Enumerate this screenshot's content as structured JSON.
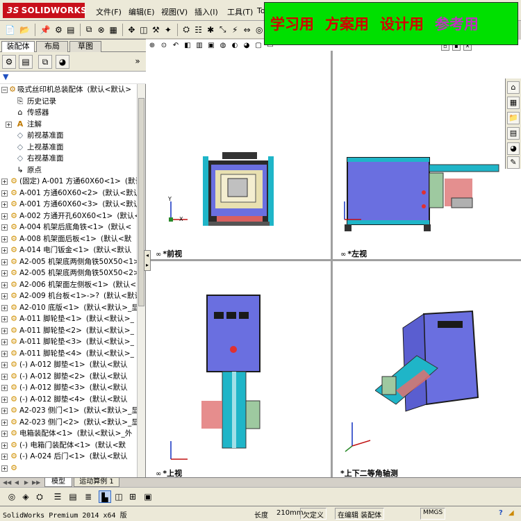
{
  "app": {
    "logo_text": "SOLIDWORKS",
    "logo_mark": "3S"
  },
  "menu": [
    {
      "label": "文件(F)"
    },
    {
      "label": "编辑(E)"
    },
    {
      "label": "视图(V)"
    },
    {
      "label": "插入(I)"
    },
    {
      "label": "工具(T)"
    },
    {
      "label": "To"
    }
  ],
  "banner": {
    "text1": "学习用",
    "text2": "方案用",
    "text3": "设计用",
    "text4": "参考用"
  },
  "panel": {
    "tabs": [
      {
        "label": "装配体"
      },
      {
        "label": "布局"
      },
      {
        "label": "草图"
      }
    ],
    "root_label": "吸式丝印机总装配体",
    "root_suffix": "(默认<默认>",
    "items": [
      {
        "label": "历史记录",
        "icon": "history-icon"
      },
      {
        "label": "传感器",
        "icon": "sensor-icon"
      },
      {
        "label": "注解",
        "icon": "annotation-icon"
      },
      {
        "label": "前视基准面",
        "icon": "plane-icon"
      },
      {
        "label": "上视基准面",
        "icon": "plane-icon"
      },
      {
        "label": "右视基准面",
        "icon": "plane-icon"
      },
      {
        "label": "原点",
        "icon": "origin-icon"
      },
      {
        "label": "(固定) A-001 方通60X60<1>",
        "suffix": "(默认"
      },
      {
        "label": "A-001 方通60X60<2>",
        "suffix": "(默认<默认"
      },
      {
        "label": "A-001 方通60X60<3>",
        "suffix": "(默认<默认"
      },
      {
        "label": "A-002 方通开孔60X60<1>",
        "suffix": "(默认<"
      },
      {
        "label": "A-004 机架后底角铁<1>",
        "suffix": "(默认<"
      },
      {
        "label": "A-008 机架面后板<1>",
        "suffix": "(默认<默"
      },
      {
        "label": "A-014 电门钣金<1>",
        "suffix": "(默认<默认"
      },
      {
        "label": "A2-005 机架底两侧角铁50X50<1>",
        "suffix": ""
      },
      {
        "label": "A2-005 机架底两侧角铁50X50<2>",
        "suffix": ""
      },
      {
        "label": "A2-006 机架面左侧板<1>",
        "suffix": "(默认<"
      },
      {
        "label": "A2-009 机台板<1>->?",
        "suffix": "(默认<默认"
      },
      {
        "label": "A2-010 底版<1>",
        "suffix": "(默认<默认>_显"
      },
      {
        "label": "A-011 脚轮垫<1>",
        "suffix": "(默认<默认>_"
      },
      {
        "label": "A-011 脚轮垫<2>",
        "suffix": "(默认<默认>_"
      },
      {
        "label": "A-011 脚轮垫<3>",
        "suffix": "(默认<默认>_"
      },
      {
        "label": "A-011 脚轮垫<4>",
        "suffix": "(默认<默认>_"
      },
      {
        "label": "(-) A-012 脚垫<1>",
        "suffix": "(默认<默认"
      },
      {
        "label": "(-) A-012 脚垫<2>",
        "suffix": "(默认<默认"
      },
      {
        "label": "(-) A-012 脚垫<3>",
        "suffix": "(默认<默认"
      },
      {
        "label": "(-) A-012 脚垫<4>",
        "suffix": "(默认<默认"
      },
      {
        "label": "A2-023 侧门<1>",
        "suffix": "(默认<默认>_显"
      },
      {
        "label": "A2-023 侧门<2>",
        "suffix": "(默认<默认>_显"
      },
      {
        "label": "电箱装配体<1>",
        "suffix": "(默认<默认>_外"
      },
      {
        "label": "(-) 电箱门装配体<1>",
        "suffix": "(默认<默"
      },
      {
        "label": "(-) A-024 后门<1>",
        "suffix": "(默认<默认"
      }
    ]
  },
  "viewports": {
    "front": "*前视",
    "left": "*左视",
    "top": "*上视",
    "iso": "*上下二等角轴测",
    "axis_x": "X",
    "axis_y": "Y"
  },
  "bottom_tabs": [
    {
      "label": "模型"
    },
    {
      "label": "运动算例 1"
    }
  ],
  "status": {
    "version": "SolidWorks Premium 2014 x64 版",
    "length_label": "长度",
    "length_value": "210mm",
    "undefined": "欠定义",
    "editing": "在编辑 装配体",
    "units": "MMGS",
    "help": "?"
  },
  "colors": {
    "accent": "#00e000",
    "banner_red": "#d40000",
    "banner_purple": "#c030c0",
    "part_blue": "#6a6fe0",
    "part_cyan": "#1fb5c8",
    "part_red": "#d86060"
  }
}
